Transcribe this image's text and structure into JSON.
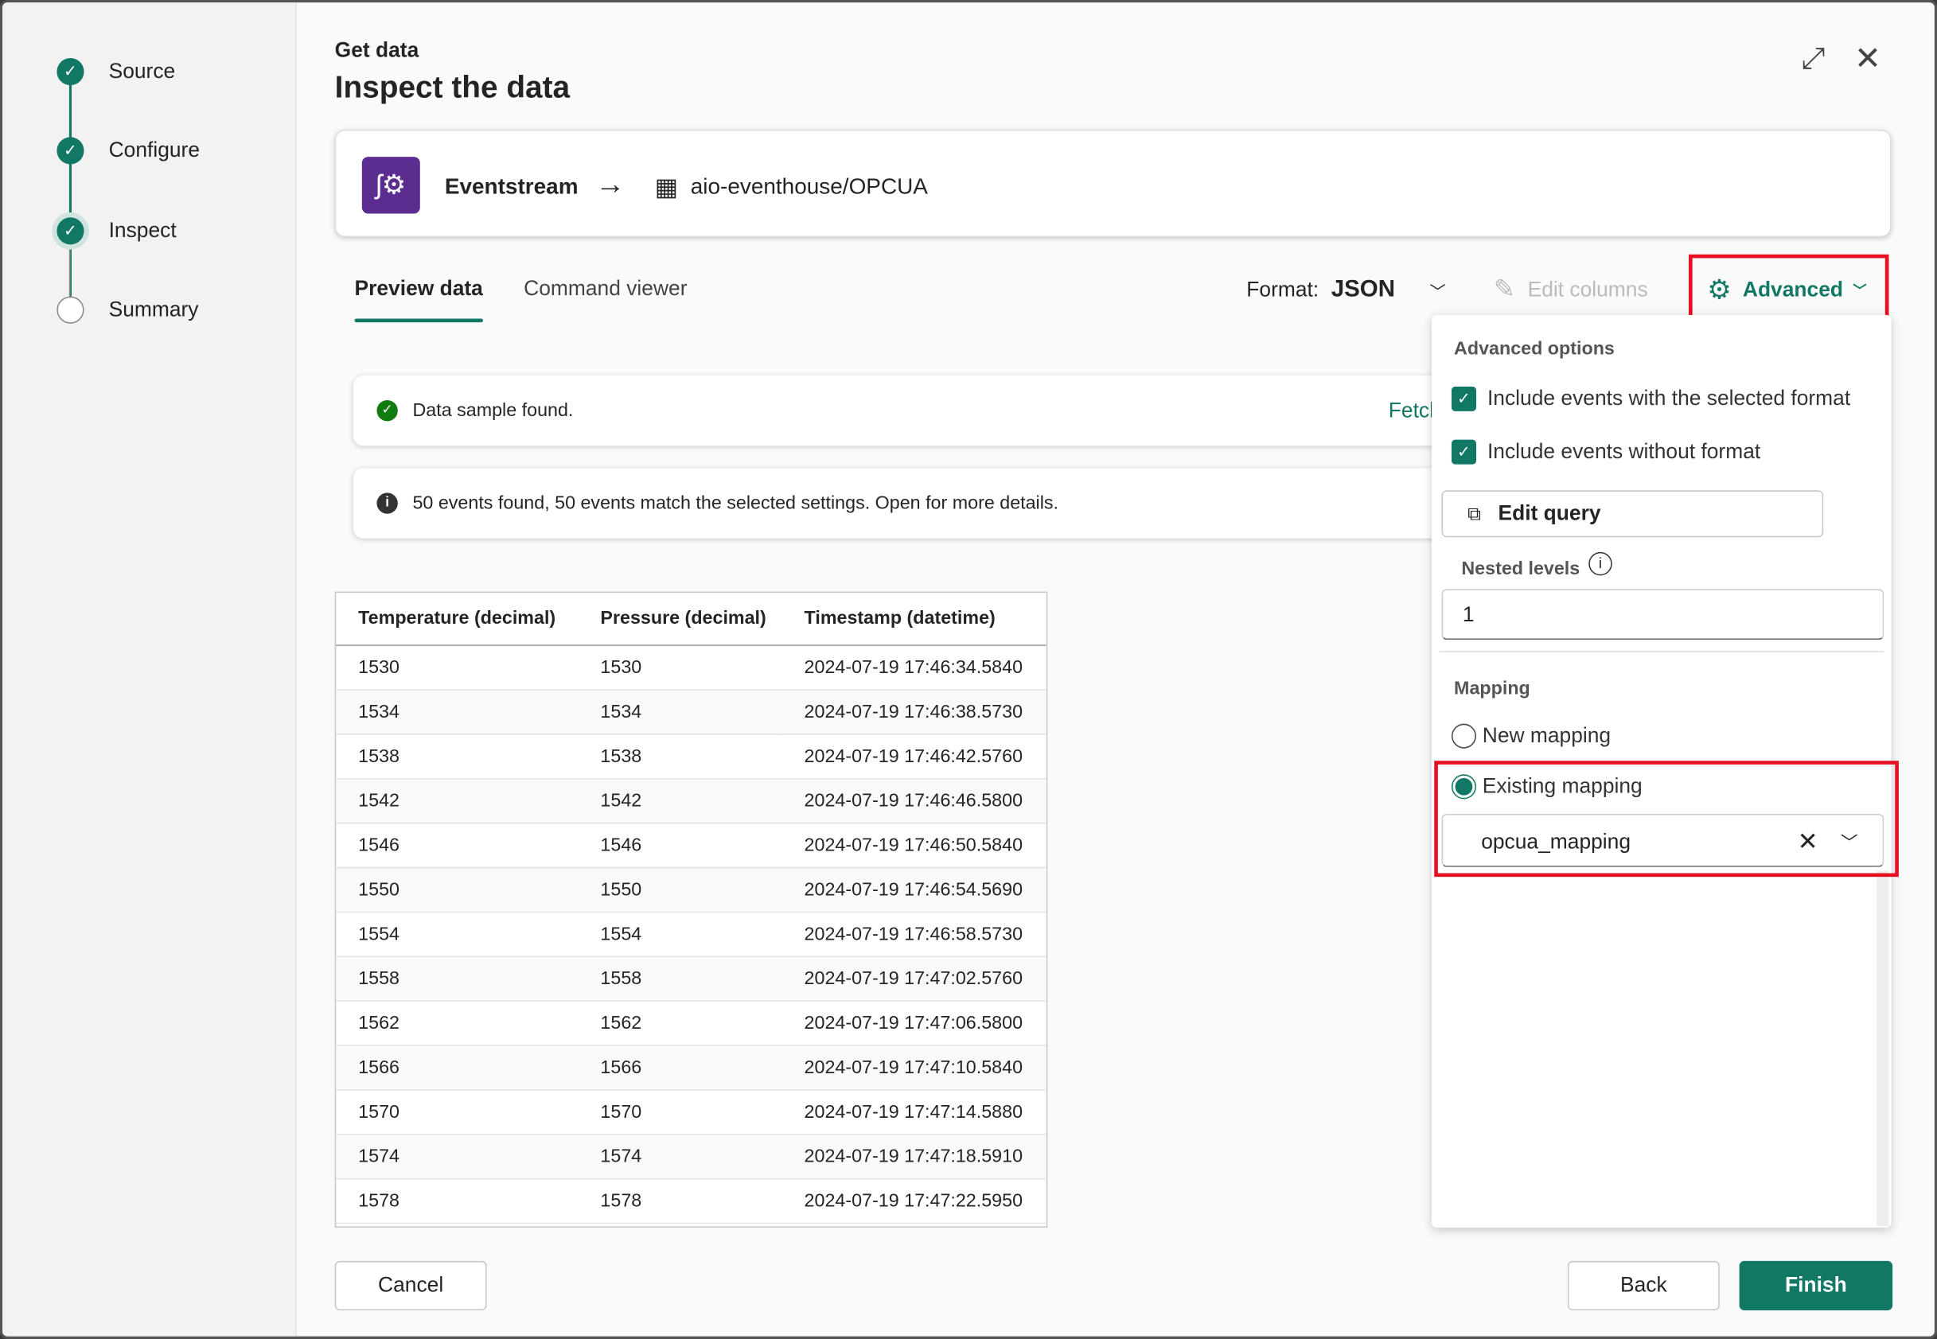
{
  "steps": [
    {
      "label": "Source",
      "state": "done"
    },
    {
      "label": "Configure",
      "state": "done"
    },
    {
      "label": "Inspect",
      "state": "done"
    },
    {
      "label": "Summary",
      "state": "pending"
    }
  ],
  "header": {
    "eyebrow": "Get data",
    "title": "Inspect the data"
  },
  "pipeline": {
    "source": "Eventstream",
    "destination": "aio-eventhouse/OPCUA"
  },
  "tabs": [
    {
      "label": "Preview data",
      "active": true
    },
    {
      "label": "Command viewer",
      "active": false
    }
  ],
  "toolbar": {
    "format_label": "Format:",
    "format_value": "JSON",
    "edit_columns": "Edit columns",
    "advanced": "Advanced"
  },
  "status": {
    "sample": "Data sample found.",
    "fetch": "Fetch",
    "events": "50 events found, 50 events match the selected settings. Open for more details."
  },
  "table": {
    "columns": [
      "Temperature (decimal)",
      "Pressure (decimal)",
      "Timestamp (datetime)"
    ],
    "rows": [
      [
        "1530",
        "1530",
        "2024-07-19 17:46:34.5840"
      ],
      [
        "1534",
        "1534",
        "2024-07-19 17:46:38.5730"
      ],
      [
        "1538",
        "1538",
        "2024-07-19 17:46:42.5760"
      ],
      [
        "1542",
        "1542",
        "2024-07-19 17:46:46.5800"
      ],
      [
        "1546",
        "1546",
        "2024-07-19 17:46:50.5840"
      ],
      [
        "1550",
        "1550",
        "2024-07-19 17:46:54.5690"
      ],
      [
        "1554",
        "1554",
        "2024-07-19 17:46:58.5730"
      ],
      [
        "1558",
        "1558",
        "2024-07-19 17:47:02.5760"
      ],
      [
        "1562",
        "1562",
        "2024-07-19 17:47:06.5800"
      ],
      [
        "1566",
        "1566",
        "2024-07-19 17:47:10.5840"
      ],
      [
        "1570",
        "1570",
        "2024-07-19 17:47:14.5880"
      ],
      [
        "1574",
        "1574",
        "2024-07-19 17:47:18.5910"
      ],
      [
        "1578",
        "1578",
        "2024-07-19 17:47:22.5950"
      ]
    ]
  },
  "advanced": {
    "title": "Advanced options",
    "include_selected": "Include events with the selected format",
    "include_without": "Include events without format",
    "edit_query": "Edit query",
    "nested_label": "Nested levels",
    "nested_value": "1",
    "mapping_label": "Mapping",
    "new_mapping": "New mapping",
    "existing_mapping": "Existing mapping",
    "mapping_value": "opcua_mapping"
  },
  "footer": {
    "cancel": "Cancel",
    "back": "Back",
    "finish": "Finish"
  },
  "colors": {
    "accent": "#117865",
    "highlight": "#e81123",
    "source_icon": "#5c2d91"
  }
}
